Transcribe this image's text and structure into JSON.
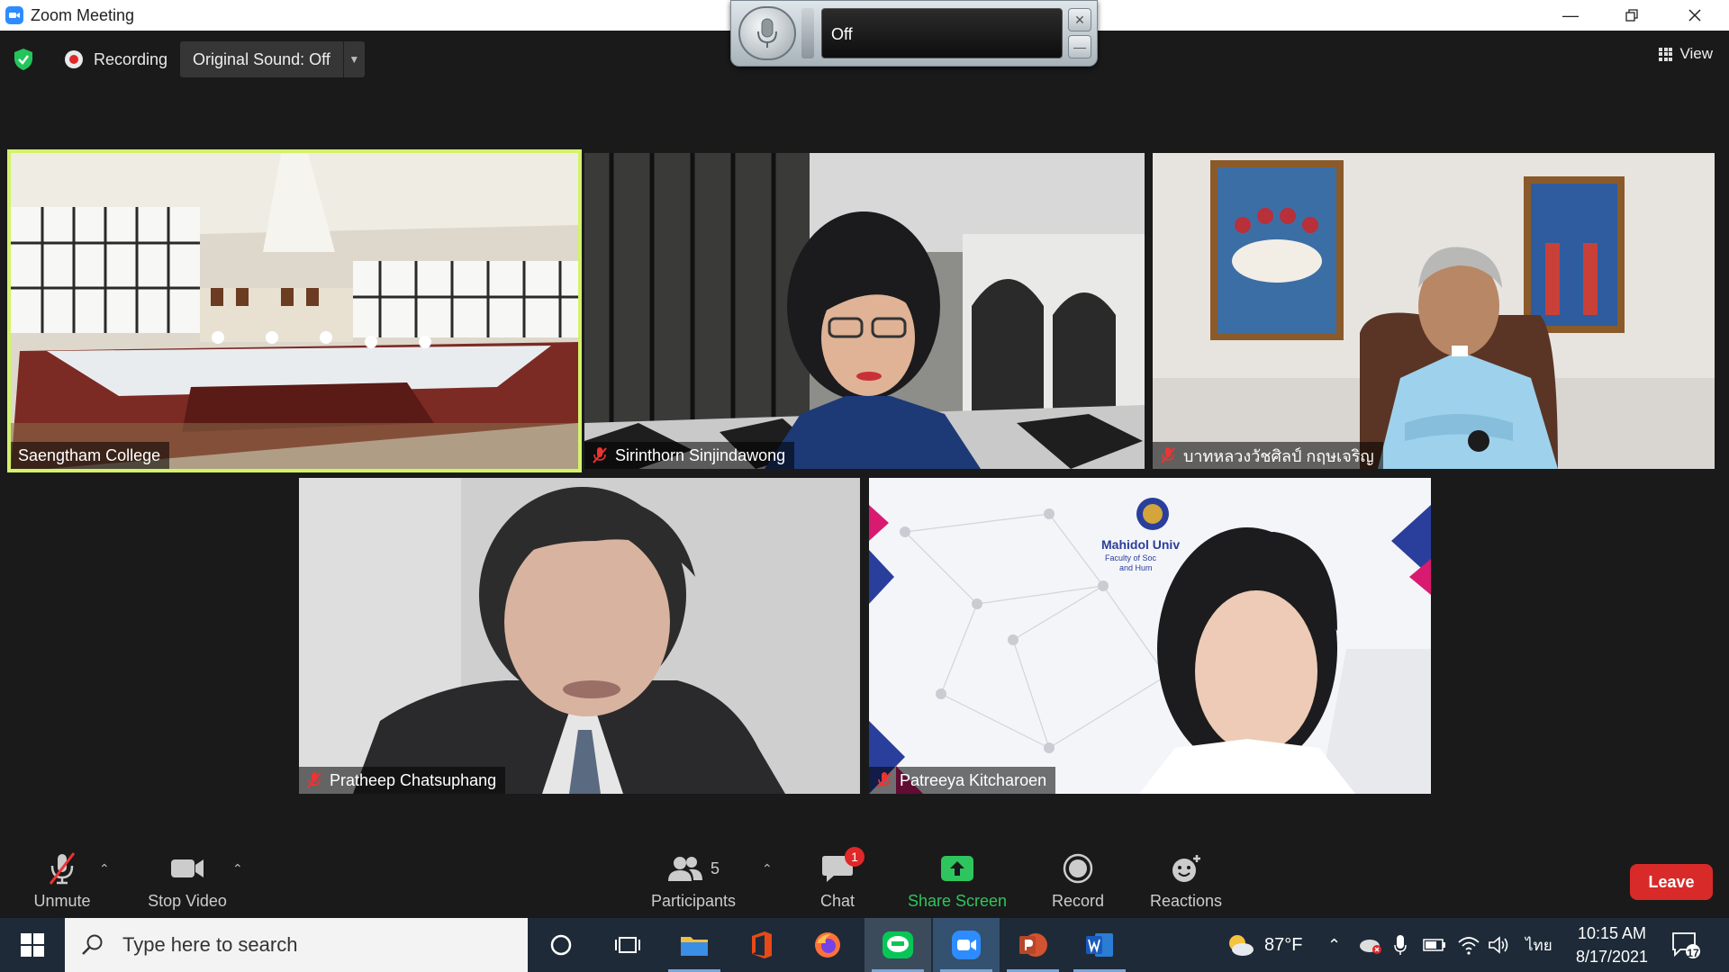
{
  "window": {
    "title": "Zoom Meeting"
  },
  "audio_widget": {
    "status": "Off"
  },
  "infobar": {
    "recording_label": "Recording",
    "original_sound_label": "Original Sound: Off"
  },
  "view_button": {
    "label": "View"
  },
  "participants_tiles": [
    {
      "name": "Saengtham College",
      "muted": false,
      "active_speaker": true
    },
    {
      "name": "Sirinthorn Sinjindawong",
      "muted": true,
      "active_speaker": false
    },
    {
      "name": "บาทหลวงวัชศิลป์  กฤษเจริญ",
      "muted": true,
      "active_speaker": false
    },
    {
      "name": "Pratheep Chatsuphang",
      "muted": true,
      "active_speaker": false
    },
    {
      "name": "Patreeya Kitcharoen",
      "muted": true,
      "active_speaker": false
    }
  ],
  "background_text": {
    "logo_line1": "Mahidol Univ",
    "logo_line2": "Faculty of Soc",
    "logo_line3": "and Hum"
  },
  "toolbar": {
    "unmute_label": "Unmute",
    "stop_video_label": "Stop Video",
    "participants_label": "Participants",
    "participants_count": "5",
    "chat_label": "Chat",
    "chat_badge": "1",
    "share_label": "Share Screen",
    "record_label": "Record",
    "reactions_label": "Reactions",
    "leave_label": "Leave"
  },
  "taskbar": {
    "search_placeholder": "Type here to search",
    "weather": "87°F",
    "language": "ไทย",
    "time": "10:15 AM",
    "date": "8/17/2021",
    "notification_count": "17"
  },
  "colors": {
    "active_speaker_border": "#d4f26a",
    "share_green": "#2fc55e",
    "leave_red": "#d92a2a",
    "zoom_blue": "#2d8cff"
  }
}
